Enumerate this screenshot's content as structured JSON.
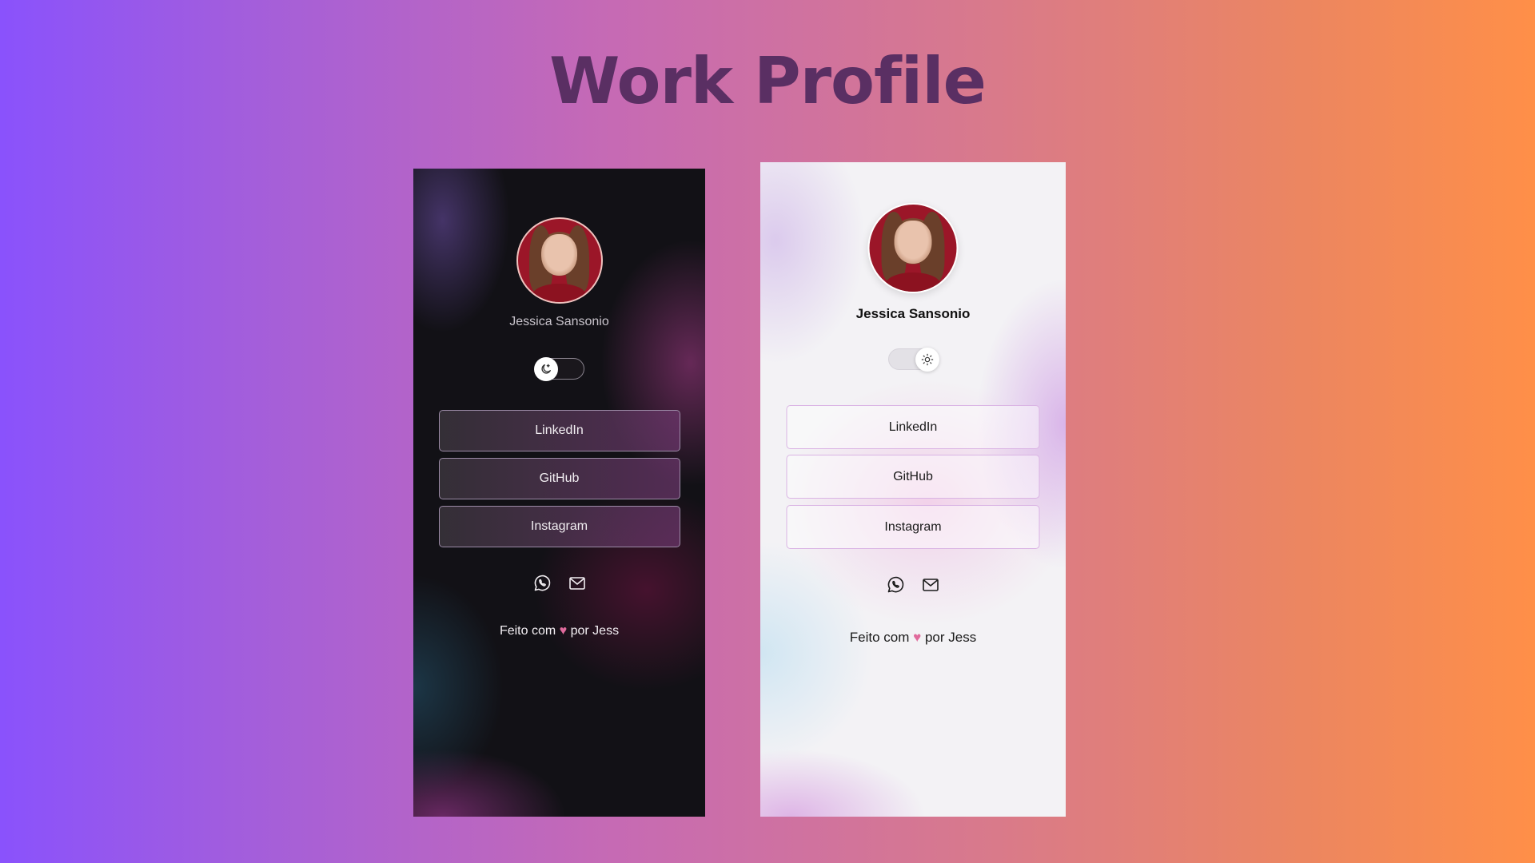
{
  "page": {
    "title": "Work Profile"
  },
  "dark_card": {
    "theme": "dark",
    "name": "Jessica Sansonio",
    "toggle_state": "dark",
    "links": [
      "LinkedIn",
      "GitHub",
      "Instagram"
    ],
    "contact_icons": [
      "whatsapp-icon",
      "mail-icon"
    ],
    "footer": {
      "prefix": "Feito com",
      "heart": "♥",
      "suffix": "por Jess"
    }
  },
  "light_card": {
    "theme": "light",
    "name": "Jessica Sansonio",
    "toggle_state": "light",
    "links": [
      "LinkedIn",
      "GitHub",
      "Instagram"
    ],
    "contact_icons": [
      "whatsapp-icon",
      "mail-icon"
    ],
    "footer": {
      "prefix": "Feito com",
      "heart": "♥",
      "suffix": "por Jess"
    }
  },
  "colors": {
    "title": "#5a2f63",
    "background_start": "#8a52fc",
    "background_end": "#ff8f48",
    "heart": "#e06a9c"
  }
}
